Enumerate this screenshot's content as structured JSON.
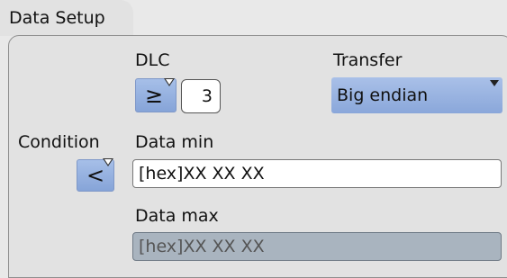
{
  "dialog": {
    "title": "Data Setup"
  },
  "dlc": {
    "label": "DLC",
    "operator": "≥",
    "value": "3"
  },
  "transfer": {
    "label": "Transfer",
    "value": "Big endian"
  },
  "condition": {
    "label": "Condition",
    "operator": "<"
  },
  "data_min": {
    "label": "Data min",
    "value": "[hex]XX XX XX"
  },
  "data_max": {
    "label": "Data max",
    "value": "[hex]XX XX XX"
  }
}
